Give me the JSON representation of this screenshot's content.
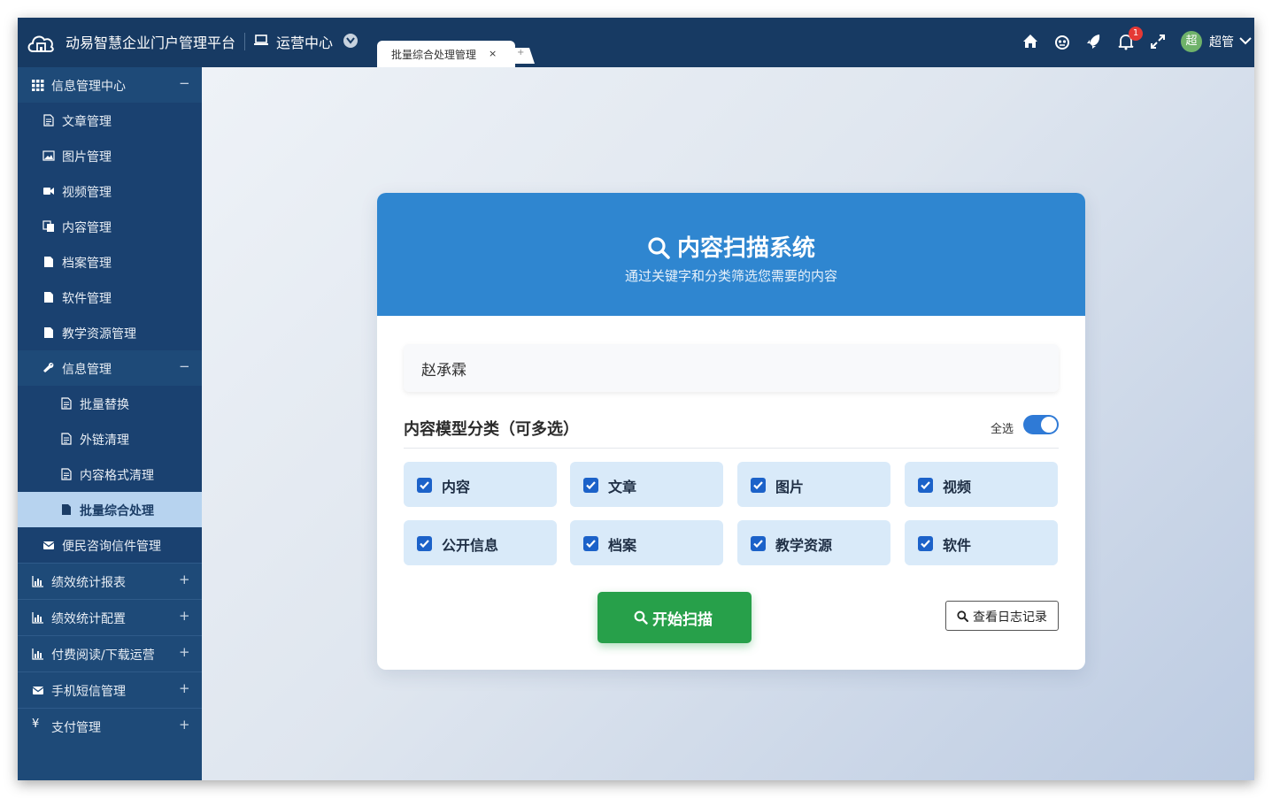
{
  "topbar": {
    "app_title": "动易智慧企业门户管理平台",
    "ops_center": "运营中心",
    "tab_label": "批量综合处理管理",
    "tab_close": "×",
    "tab_add": "+",
    "notification_count": "1",
    "avatar_text": "超",
    "user_name": "超管",
    "icons": [
      "home-icon",
      "robot-icon",
      "rocket-icon",
      "bell-icon",
      "fullscreen-icon",
      "chevron-down-icon"
    ]
  },
  "sidebar": {
    "items": [
      {
        "label": "信息管理中心",
        "toggle": "−"
      },
      {
        "label": "文章管理"
      },
      {
        "label": "图片管理"
      },
      {
        "label": "视频管理"
      },
      {
        "label": "内容管理"
      },
      {
        "label": "档案管理"
      },
      {
        "label": "软件管理"
      },
      {
        "label": "教学资源管理"
      },
      {
        "label": "信息管理",
        "toggle": "−"
      },
      {
        "label": "批量替换"
      },
      {
        "label": "外链清理"
      },
      {
        "label": "内容格式清理"
      },
      {
        "label": "批量综合处理"
      },
      {
        "label": "便民咨询信件管理"
      },
      {
        "label": "绩效统计报表",
        "toggle": "+"
      },
      {
        "label": "绩效统计配置",
        "toggle": "+"
      },
      {
        "label": "付费阅读/下载运营",
        "toggle": "+"
      },
      {
        "label": "手机短信管理",
        "toggle": "+"
      },
      {
        "label": "支付管理",
        "toggle": "+",
        "icon_text": "¥"
      }
    ]
  },
  "scanner": {
    "title": "内容扫描系统",
    "subtitle": "通过关键字和分类筛选您需要的内容",
    "keyword_value": "赵承霖",
    "section_title": "内容模型分类（可多选）",
    "select_all_label": "全选",
    "select_all_on": true,
    "options": [
      {
        "label": "内容",
        "checked": true
      },
      {
        "label": "文章",
        "checked": true
      },
      {
        "label": "图片",
        "checked": true
      },
      {
        "label": "视频",
        "checked": true
      },
      {
        "label": "公开信息",
        "checked": true
      },
      {
        "label": "档案",
        "checked": true
      },
      {
        "label": "教学资源",
        "checked": true
      },
      {
        "label": "软件",
        "checked": true
      }
    ],
    "scan_button": "开始扫描",
    "log_button": "查看日志记录"
  },
  "colors": {
    "topbar": "#173a63",
    "sidebar": "#1e4a78",
    "card_header": "#2f86d0",
    "scan_button": "#27a04a",
    "checkbox": "#1c62c9",
    "option_bg": "#d9eaf9"
  }
}
